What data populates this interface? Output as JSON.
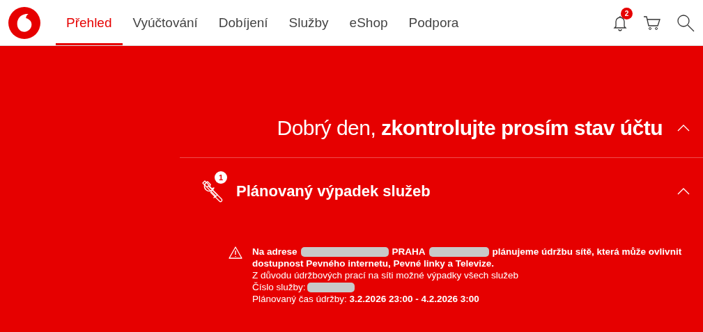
{
  "nav": {
    "items": [
      {
        "label": "Přehled",
        "selected": true
      },
      {
        "label": "Vyúčtování",
        "selected": false
      },
      {
        "label": "Dobíjení",
        "selected": false
      },
      {
        "label": "Služby",
        "selected": false
      },
      {
        "label": "eShop",
        "selected": false
      },
      {
        "label": "Podpora",
        "selected": false
      }
    ],
    "notification_count": "2"
  },
  "greeting": {
    "prefix": "Dobrý den,",
    "emphasis": "zkontrolujte prosím stav účtu",
    "expanded": true
  },
  "outage": {
    "title": "Plánovaný výpadek služeb",
    "count": "1",
    "expanded": true,
    "notice": [
      {
        "kind": "text",
        "text": "Na adrese"
      },
      {
        "kind": "redacted"
      },
      {
        "kind": "text",
        "text": "PRAHA"
      },
      {
        "kind": "redacted"
      },
      {
        "kind": "text",
        "text": "plánujeme údržbu sítě, která může ovlivnit"
      },
      {
        "kind": "text",
        "text": "dostupnost Pevného internetu, Pevné linky a Televize."
      }
    ],
    "reason": "Z důvodu údržbových prací na síti možné výpadky všech služeb",
    "service_label": "Číslo služby:",
    "time_label": "Plánovaný čas údržby:",
    "time_value": "3.2.2026 23:00 - 4.2.2026 3:00"
  }
}
